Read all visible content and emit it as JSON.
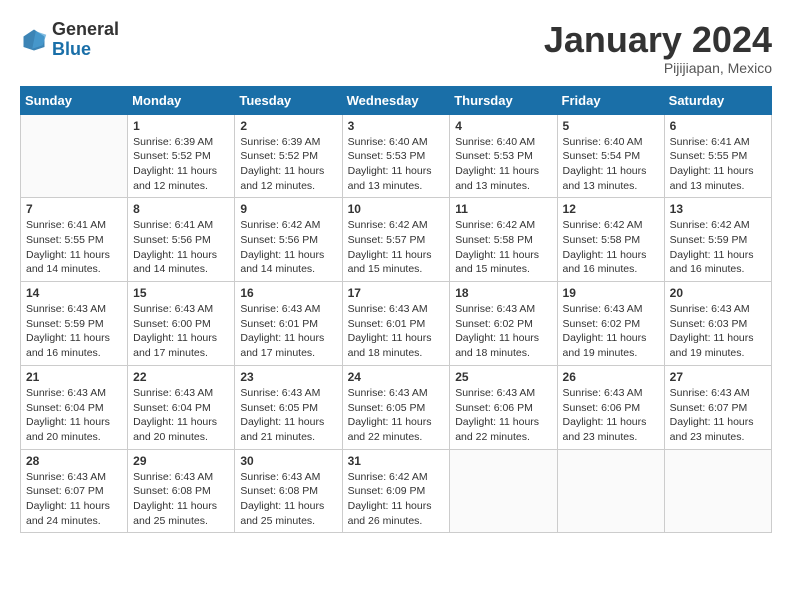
{
  "header": {
    "logo_general": "General",
    "logo_blue": "Blue",
    "month_title": "January 2024",
    "subtitle": "Pijijiapan, Mexico"
  },
  "weekdays": [
    "Sunday",
    "Monday",
    "Tuesday",
    "Wednesday",
    "Thursday",
    "Friday",
    "Saturday"
  ],
  "weeks": [
    [
      {
        "day": "",
        "sunrise": "",
        "sunset": "",
        "daylight": ""
      },
      {
        "day": "1",
        "sunrise": "Sunrise: 6:39 AM",
        "sunset": "Sunset: 5:52 PM",
        "daylight": "Daylight: 11 hours and 12 minutes."
      },
      {
        "day": "2",
        "sunrise": "Sunrise: 6:39 AM",
        "sunset": "Sunset: 5:52 PM",
        "daylight": "Daylight: 11 hours and 12 minutes."
      },
      {
        "day": "3",
        "sunrise": "Sunrise: 6:40 AM",
        "sunset": "Sunset: 5:53 PM",
        "daylight": "Daylight: 11 hours and 13 minutes."
      },
      {
        "day": "4",
        "sunrise": "Sunrise: 6:40 AM",
        "sunset": "Sunset: 5:53 PM",
        "daylight": "Daylight: 11 hours and 13 minutes."
      },
      {
        "day": "5",
        "sunrise": "Sunrise: 6:40 AM",
        "sunset": "Sunset: 5:54 PM",
        "daylight": "Daylight: 11 hours and 13 minutes."
      },
      {
        "day": "6",
        "sunrise": "Sunrise: 6:41 AM",
        "sunset": "Sunset: 5:55 PM",
        "daylight": "Daylight: 11 hours and 13 minutes."
      }
    ],
    [
      {
        "day": "7",
        "sunrise": "Sunrise: 6:41 AM",
        "sunset": "Sunset: 5:55 PM",
        "daylight": "Daylight: 11 hours and 14 minutes."
      },
      {
        "day": "8",
        "sunrise": "Sunrise: 6:41 AM",
        "sunset": "Sunset: 5:56 PM",
        "daylight": "Daylight: 11 hours and 14 minutes."
      },
      {
        "day": "9",
        "sunrise": "Sunrise: 6:42 AM",
        "sunset": "Sunset: 5:56 PM",
        "daylight": "Daylight: 11 hours and 14 minutes."
      },
      {
        "day": "10",
        "sunrise": "Sunrise: 6:42 AM",
        "sunset": "Sunset: 5:57 PM",
        "daylight": "Daylight: 11 hours and 15 minutes."
      },
      {
        "day": "11",
        "sunrise": "Sunrise: 6:42 AM",
        "sunset": "Sunset: 5:58 PM",
        "daylight": "Daylight: 11 hours and 15 minutes."
      },
      {
        "day": "12",
        "sunrise": "Sunrise: 6:42 AM",
        "sunset": "Sunset: 5:58 PM",
        "daylight": "Daylight: 11 hours and 16 minutes."
      },
      {
        "day": "13",
        "sunrise": "Sunrise: 6:42 AM",
        "sunset": "Sunset: 5:59 PM",
        "daylight": "Daylight: 11 hours and 16 minutes."
      }
    ],
    [
      {
        "day": "14",
        "sunrise": "Sunrise: 6:43 AM",
        "sunset": "Sunset: 5:59 PM",
        "daylight": "Daylight: 11 hours and 16 minutes."
      },
      {
        "day": "15",
        "sunrise": "Sunrise: 6:43 AM",
        "sunset": "Sunset: 6:00 PM",
        "daylight": "Daylight: 11 hours and 17 minutes."
      },
      {
        "day": "16",
        "sunrise": "Sunrise: 6:43 AM",
        "sunset": "Sunset: 6:01 PM",
        "daylight": "Daylight: 11 hours and 17 minutes."
      },
      {
        "day": "17",
        "sunrise": "Sunrise: 6:43 AM",
        "sunset": "Sunset: 6:01 PM",
        "daylight": "Daylight: 11 hours and 18 minutes."
      },
      {
        "day": "18",
        "sunrise": "Sunrise: 6:43 AM",
        "sunset": "Sunset: 6:02 PM",
        "daylight": "Daylight: 11 hours and 18 minutes."
      },
      {
        "day": "19",
        "sunrise": "Sunrise: 6:43 AM",
        "sunset": "Sunset: 6:02 PM",
        "daylight": "Daylight: 11 hours and 19 minutes."
      },
      {
        "day": "20",
        "sunrise": "Sunrise: 6:43 AM",
        "sunset": "Sunset: 6:03 PM",
        "daylight": "Daylight: 11 hours and 19 minutes."
      }
    ],
    [
      {
        "day": "21",
        "sunrise": "Sunrise: 6:43 AM",
        "sunset": "Sunset: 6:04 PM",
        "daylight": "Daylight: 11 hours and 20 minutes."
      },
      {
        "day": "22",
        "sunrise": "Sunrise: 6:43 AM",
        "sunset": "Sunset: 6:04 PM",
        "daylight": "Daylight: 11 hours and 20 minutes."
      },
      {
        "day": "23",
        "sunrise": "Sunrise: 6:43 AM",
        "sunset": "Sunset: 6:05 PM",
        "daylight": "Daylight: 11 hours and 21 minutes."
      },
      {
        "day": "24",
        "sunrise": "Sunrise: 6:43 AM",
        "sunset": "Sunset: 6:05 PM",
        "daylight": "Daylight: 11 hours and 22 minutes."
      },
      {
        "day": "25",
        "sunrise": "Sunrise: 6:43 AM",
        "sunset": "Sunset: 6:06 PM",
        "daylight": "Daylight: 11 hours and 22 minutes."
      },
      {
        "day": "26",
        "sunrise": "Sunrise: 6:43 AM",
        "sunset": "Sunset: 6:06 PM",
        "daylight": "Daylight: 11 hours and 23 minutes."
      },
      {
        "day": "27",
        "sunrise": "Sunrise: 6:43 AM",
        "sunset": "Sunset: 6:07 PM",
        "daylight": "Daylight: 11 hours and 23 minutes."
      }
    ],
    [
      {
        "day": "28",
        "sunrise": "Sunrise: 6:43 AM",
        "sunset": "Sunset: 6:07 PM",
        "daylight": "Daylight: 11 hours and 24 minutes."
      },
      {
        "day": "29",
        "sunrise": "Sunrise: 6:43 AM",
        "sunset": "Sunset: 6:08 PM",
        "daylight": "Daylight: 11 hours and 25 minutes."
      },
      {
        "day": "30",
        "sunrise": "Sunrise: 6:43 AM",
        "sunset": "Sunset: 6:08 PM",
        "daylight": "Daylight: 11 hours and 25 minutes."
      },
      {
        "day": "31",
        "sunrise": "Sunrise: 6:42 AM",
        "sunset": "Sunset: 6:09 PM",
        "daylight": "Daylight: 11 hours and 26 minutes."
      },
      {
        "day": "",
        "sunrise": "",
        "sunset": "",
        "daylight": ""
      },
      {
        "day": "",
        "sunrise": "",
        "sunset": "",
        "daylight": ""
      },
      {
        "day": "",
        "sunrise": "",
        "sunset": "",
        "daylight": ""
      }
    ]
  ]
}
